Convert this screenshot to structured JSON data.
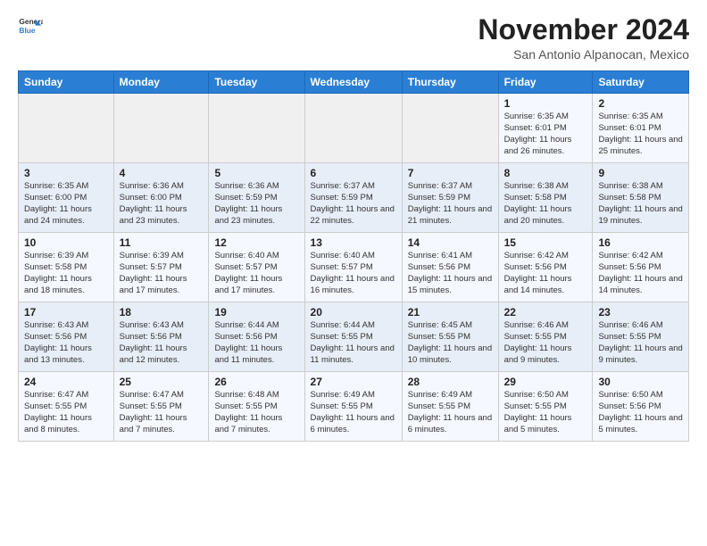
{
  "logo": {
    "line1": "General",
    "line2": "Blue"
  },
  "title": "November 2024",
  "subtitle": "San Antonio Alpanocan, Mexico",
  "days_of_week": [
    "Sunday",
    "Monday",
    "Tuesday",
    "Wednesday",
    "Thursday",
    "Friday",
    "Saturday"
  ],
  "weeks": [
    [
      {
        "day": "",
        "info": ""
      },
      {
        "day": "",
        "info": ""
      },
      {
        "day": "",
        "info": ""
      },
      {
        "day": "",
        "info": ""
      },
      {
        "day": "",
        "info": ""
      },
      {
        "day": "1",
        "info": "Sunrise: 6:35 AM\nSunset: 6:01 PM\nDaylight: 11 hours and 26 minutes."
      },
      {
        "day": "2",
        "info": "Sunrise: 6:35 AM\nSunset: 6:01 PM\nDaylight: 11 hours and 25 minutes."
      }
    ],
    [
      {
        "day": "3",
        "info": "Sunrise: 6:35 AM\nSunset: 6:00 PM\nDaylight: 11 hours and 24 minutes."
      },
      {
        "day": "4",
        "info": "Sunrise: 6:36 AM\nSunset: 6:00 PM\nDaylight: 11 hours and 23 minutes."
      },
      {
        "day": "5",
        "info": "Sunrise: 6:36 AM\nSunset: 5:59 PM\nDaylight: 11 hours and 23 minutes."
      },
      {
        "day": "6",
        "info": "Sunrise: 6:37 AM\nSunset: 5:59 PM\nDaylight: 11 hours and 22 minutes."
      },
      {
        "day": "7",
        "info": "Sunrise: 6:37 AM\nSunset: 5:59 PM\nDaylight: 11 hours and 21 minutes."
      },
      {
        "day": "8",
        "info": "Sunrise: 6:38 AM\nSunset: 5:58 PM\nDaylight: 11 hours and 20 minutes."
      },
      {
        "day": "9",
        "info": "Sunrise: 6:38 AM\nSunset: 5:58 PM\nDaylight: 11 hours and 19 minutes."
      }
    ],
    [
      {
        "day": "10",
        "info": "Sunrise: 6:39 AM\nSunset: 5:58 PM\nDaylight: 11 hours and 18 minutes."
      },
      {
        "day": "11",
        "info": "Sunrise: 6:39 AM\nSunset: 5:57 PM\nDaylight: 11 hours and 17 minutes."
      },
      {
        "day": "12",
        "info": "Sunrise: 6:40 AM\nSunset: 5:57 PM\nDaylight: 11 hours and 17 minutes."
      },
      {
        "day": "13",
        "info": "Sunrise: 6:40 AM\nSunset: 5:57 PM\nDaylight: 11 hours and 16 minutes."
      },
      {
        "day": "14",
        "info": "Sunrise: 6:41 AM\nSunset: 5:56 PM\nDaylight: 11 hours and 15 minutes."
      },
      {
        "day": "15",
        "info": "Sunrise: 6:42 AM\nSunset: 5:56 PM\nDaylight: 11 hours and 14 minutes."
      },
      {
        "day": "16",
        "info": "Sunrise: 6:42 AM\nSunset: 5:56 PM\nDaylight: 11 hours and 14 minutes."
      }
    ],
    [
      {
        "day": "17",
        "info": "Sunrise: 6:43 AM\nSunset: 5:56 PM\nDaylight: 11 hours and 13 minutes."
      },
      {
        "day": "18",
        "info": "Sunrise: 6:43 AM\nSunset: 5:56 PM\nDaylight: 11 hours and 12 minutes."
      },
      {
        "day": "19",
        "info": "Sunrise: 6:44 AM\nSunset: 5:56 PM\nDaylight: 11 hours and 11 minutes."
      },
      {
        "day": "20",
        "info": "Sunrise: 6:44 AM\nSunset: 5:55 PM\nDaylight: 11 hours and 11 minutes."
      },
      {
        "day": "21",
        "info": "Sunrise: 6:45 AM\nSunset: 5:55 PM\nDaylight: 11 hours and 10 minutes."
      },
      {
        "day": "22",
        "info": "Sunrise: 6:46 AM\nSunset: 5:55 PM\nDaylight: 11 hours and 9 minutes."
      },
      {
        "day": "23",
        "info": "Sunrise: 6:46 AM\nSunset: 5:55 PM\nDaylight: 11 hours and 9 minutes."
      }
    ],
    [
      {
        "day": "24",
        "info": "Sunrise: 6:47 AM\nSunset: 5:55 PM\nDaylight: 11 hours and 8 minutes."
      },
      {
        "day": "25",
        "info": "Sunrise: 6:47 AM\nSunset: 5:55 PM\nDaylight: 11 hours and 7 minutes."
      },
      {
        "day": "26",
        "info": "Sunrise: 6:48 AM\nSunset: 5:55 PM\nDaylight: 11 hours and 7 minutes."
      },
      {
        "day": "27",
        "info": "Sunrise: 6:49 AM\nSunset: 5:55 PM\nDaylight: 11 hours and 6 minutes."
      },
      {
        "day": "28",
        "info": "Sunrise: 6:49 AM\nSunset: 5:55 PM\nDaylight: 11 hours and 6 minutes."
      },
      {
        "day": "29",
        "info": "Sunrise: 6:50 AM\nSunset: 5:55 PM\nDaylight: 11 hours and 5 minutes."
      },
      {
        "day": "30",
        "info": "Sunrise: 6:50 AM\nSunset: 5:56 PM\nDaylight: 11 hours and 5 minutes."
      }
    ]
  ]
}
